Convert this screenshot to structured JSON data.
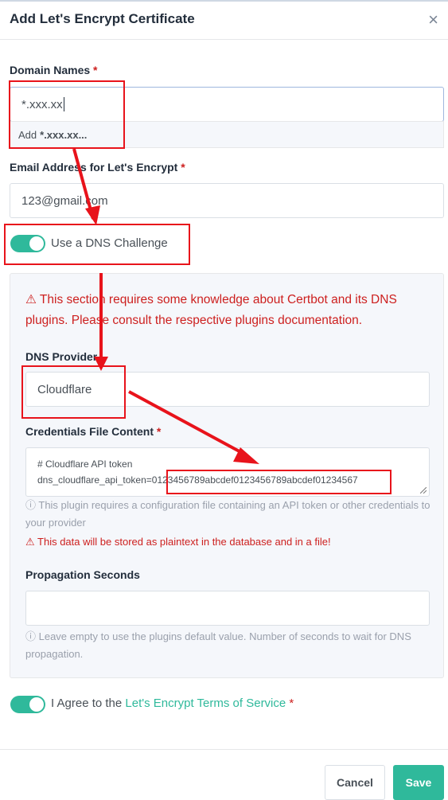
{
  "modal": {
    "title": "Add Let's Encrypt Certificate",
    "close": "×"
  },
  "domain": {
    "label": "Domain Names",
    "required": "*",
    "value": "*.xxx.xx",
    "suggestion_prefix": "Add",
    "suggestion_value": "*.xxx.xx..."
  },
  "email": {
    "label": "Email Address for Let's Encrypt",
    "required": "*",
    "value": "123@gmail.com"
  },
  "dns_challenge": {
    "label": "Use a DNS Challenge",
    "enabled": true
  },
  "dns_panel": {
    "warning": "⚠ This section requires some knowledge about Certbot and its DNS plugins. Please consult the respective plugins documentation.",
    "provider_label": "DNS Provider",
    "provider_value": "Cloudflare",
    "credentials_label": "Credentials File Content",
    "credentials_required": "*",
    "credentials_line1": "# Cloudflare API token",
    "credentials_key": "dns_cloudflare_api_token=",
    "credentials_token": "0123456789abcdef0123456789abcdef01234567",
    "credentials_help": "ⓘ This plugin requires a configuration file containing an API token or other credentials to your provider",
    "credentials_warning": "⚠ This data will be stored as plaintext in the database and in a file!",
    "propagation_label": "Propagation Seconds",
    "propagation_value": "",
    "propagation_help": "ⓘ Leave empty to use the plugins default value. Number of seconds to wait for DNS propagation."
  },
  "agree": {
    "prefix": "I Agree to the",
    "link": "Let's Encrypt Terms of Service",
    "required": "*",
    "enabled": true
  },
  "footer": {
    "cancel": "Cancel",
    "save": "Save"
  },
  "colors": {
    "accent": "#2fb99b",
    "danger": "#cd201f",
    "annotation": "#e8131b"
  }
}
